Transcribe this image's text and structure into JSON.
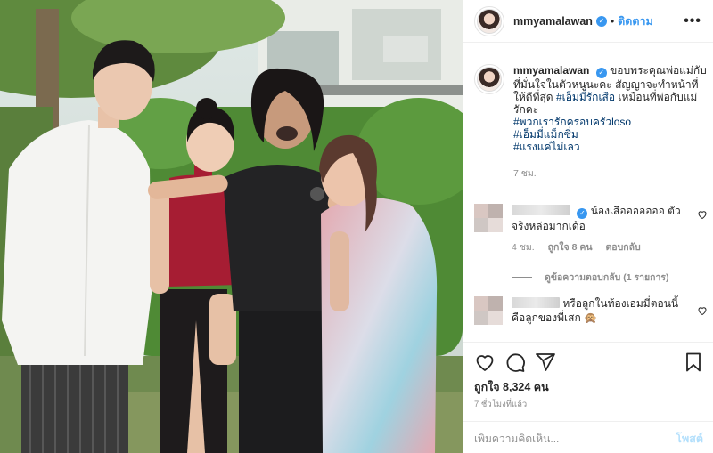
{
  "post": {
    "username": "mmyamalawan",
    "follow_label": "ติดตาม",
    "more_label": "•••"
  },
  "caption": {
    "username": "mmyamalawan",
    "text": "ขอบพระคุณพ่อแม่กับที่มั่นใจในตัวหนูนะคะ สัญญาจะทำหน้าที่ให้ดีที่สุด",
    "hashtag_1": "#เอ็มมี่รักเสือ",
    "line_after_1": "เหมือนที่พ่อกับแม่รักคะ",
    "hashtag_2": "#พวกเรารักครอบครัวloso",
    "hashtag_3": "#เอ็มมี่แม็กซิ่ม",
    "hashtag_4": "#แรงแค่ไม่เลว",
    "time": "7 ชม."
  },
  "comments": [
    {
      "text": "น้องเสือออออออ ตัวจริงหล่อมากเด้อ",
      "time": "4 ชม.",
      "likes": "ถูกใจ 8 คน",
      "reply_label": "ตอบกลับ",
      "view_replies": "ดูข้อความตอบกลับ (1 รายการ)"
    },
    {
      "text": "หรือลูกในท้องเอมมี่ตอนนี้คือลูกของพี่เสก 🙊"
    }
  ],
  "footer": {
    "likes": "ถูกใจ 8,324 คน",
    "ago": "7 ชั่วโมงที่แล้ว",
    "comment_placeholder": "เพิ่มความคิดเห็น...",
    "post_label": "โพสต์"
  },
  "icons": [
    "heart-icon",
    "comment-icon",
    "share-icon",
    "bookmark-icon",
    "more-icon",
    "verified-badge-icon"
  ],
  "colors": {
    "accent": "#3897f0",
    "hashtag": "#00376b",
    "muted": "#8e8e8e",
    "post_disabled": "#b2dffc"
  }
}
